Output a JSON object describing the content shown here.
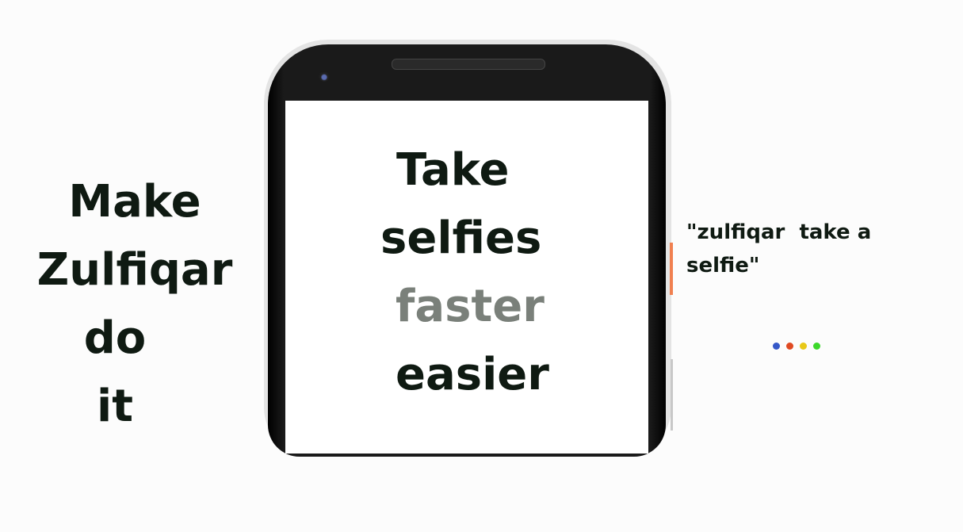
{
  "left_text": [
    "Make",
    "Zulfiqar",
    "do",
    "it"
  ],
  "screen_text": {
    "line1": "Take",
    "line2": "selfies",
    "line3": "faster",
    "line4": "easier"
  },
  "quote": {
    "line1": "\"zulfiqar  take a",
    "line2": "selfie\""
  },
  "colors": {
    "text": "#0f1a12",
    "muted": "#7a807a",
    "dots": [
      "#3558c8",
      "#e04a22",
      "#e8c818",
      "#3cd82a"
    ]
  }
}
